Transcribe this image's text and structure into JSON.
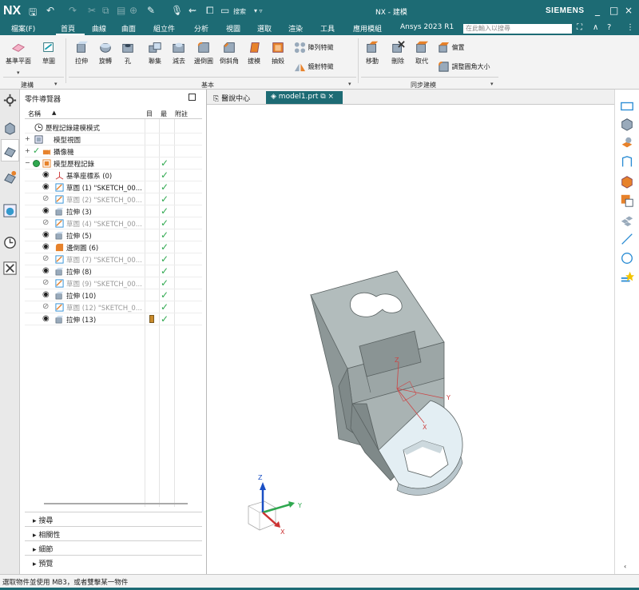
{
  "titlebar": {
    "logo": "NX",
    "window_title": "NX - 建模",
    "brand": "SIEMENS",
    "quick_access_search": "搜索",
    "controls": [
      "_",
      "□",
      "×"
    ]
  },
  "menubar": {
    "items": [
      "檔案(F)",
      "首頁",
      "曲線",
      "曲面",
      "組立件",
      "分析",
      "視圖",
      "選取",
      "渲染",
      "工具",
      "應用模組",
      "Ansys 2023 R1"
    ],
    "active": "首頁",
    "search_placeholder": "在此輸入以搜尋"
  },
  "ribbon": {
    "buttons": {
      "datum_plane": "基準平面",
      "sketch": "草圖",
      "extrude": "拉伸",
      "revolve": "旋轉",
      "hole": "孔",
      "unite": "聯集",
      "subtract": "減去",
      "edge_blend": "邊倒圓",
      "chamfer": "倒斜角",
      "draft": "拔模",
      "shell": "抽殼",
      "pattern_feature": "陣列特徵",
      "mirror_feature": "鏡射特徵",
      "move": "移動",
      "delete": "刪除",
      "replace": "取代",
      "offset": "偏置",
      "resize_blend": "調整圓角大小"
    },
    "groups": {
      "construct": "建構",
      "basic": "基本",
      "sync": "同步建模"
    }
  },
  "navigator": {
    "title": "零件導覽器",
    "headers": {
      "name": "名稱",
      "up": "▲",
      "current": "目",
      "latest": "最",
      "comment": "附註"
    },
    "rows": [
      {
        "label": "歷程記錄建模模式",
        "dim": false,
        "check": ""
      },
      {
        "label": "模型視圖",
        "dim": false,
        "check": ""
      },
      {
        "label": "攝像機",
        "dim": false,
        "check": ""
      },
      {
        "label": "模型歷程記錄",
        "dim": false,
        "check": "✓"
      },
      {
        "label": "基準座標系 (0)",
        "dim": false,
        "check": "✓"
      },
      {
        "label": "草圖 (1) \"SKETCH_00...",
        "dim": false,
        "check": "✓"
      },
      {
        "label": "草圖 (2) \"SKETCH_00...",
        "dim": true,
        "check": "✓"
      },
      {
        "label": "拉伸 (3)",
        "dim": false,
        "check": "✓"
      },
      {
        "label": "草圖 (4) \"SKETCH_00...",
        "dim": true,
        "check": "✓"
      },
      {
        "label": "拉伸 (5)",
        "dim": false,
        "check": "✓"
      },
      {
        "label": "邊倒圓 (6)",
        "dim": false,
        "check": "✓"
      },
      {
        "label": "草圖 (7) \"SKETCH_00...",
        "dim": true,
        "check": "✓"
      },
      {
        "label": "拉伸 (8)",
        "dim": false,
        "check": "✓"
      },
      {
        "label": "草圖 (9) \"SKETCH_00...",
        "dim": true,
        "check": "✓"
      },
      {
        "label": "拉伸 (10)",
        "dim": false,
        "check": "✓"
      },
      {
        "label": "草圖 (12) \"SKETCH_0...",
        "dim": true,
        "check": "✓"
      },
      {
        "label": "拉伸 (13)",
        "dim": false,
        "check": "✓"
      }
    ],
    "panels": [
      "搜尋",
      "相關性",
      "細節",
      "預覽"
    ]
  },
  "tabs": {
    "home": "醫說中心",
    "model": "model1.prt"
  },
  "viewport": {
    "triad_axes": [
      "X",
      "Y",
      "Z"
    ]
  },
  "status": {
    "message": "選取物件並使用 MB3，或者雙擊某一物件"
  },
  "colors": {
    "accent": "#1d6b74",
    "check": "#2fa84f",
    "part_gray": "#a9b3b3",
    "part_light": "#e3eef3"
  }
}
